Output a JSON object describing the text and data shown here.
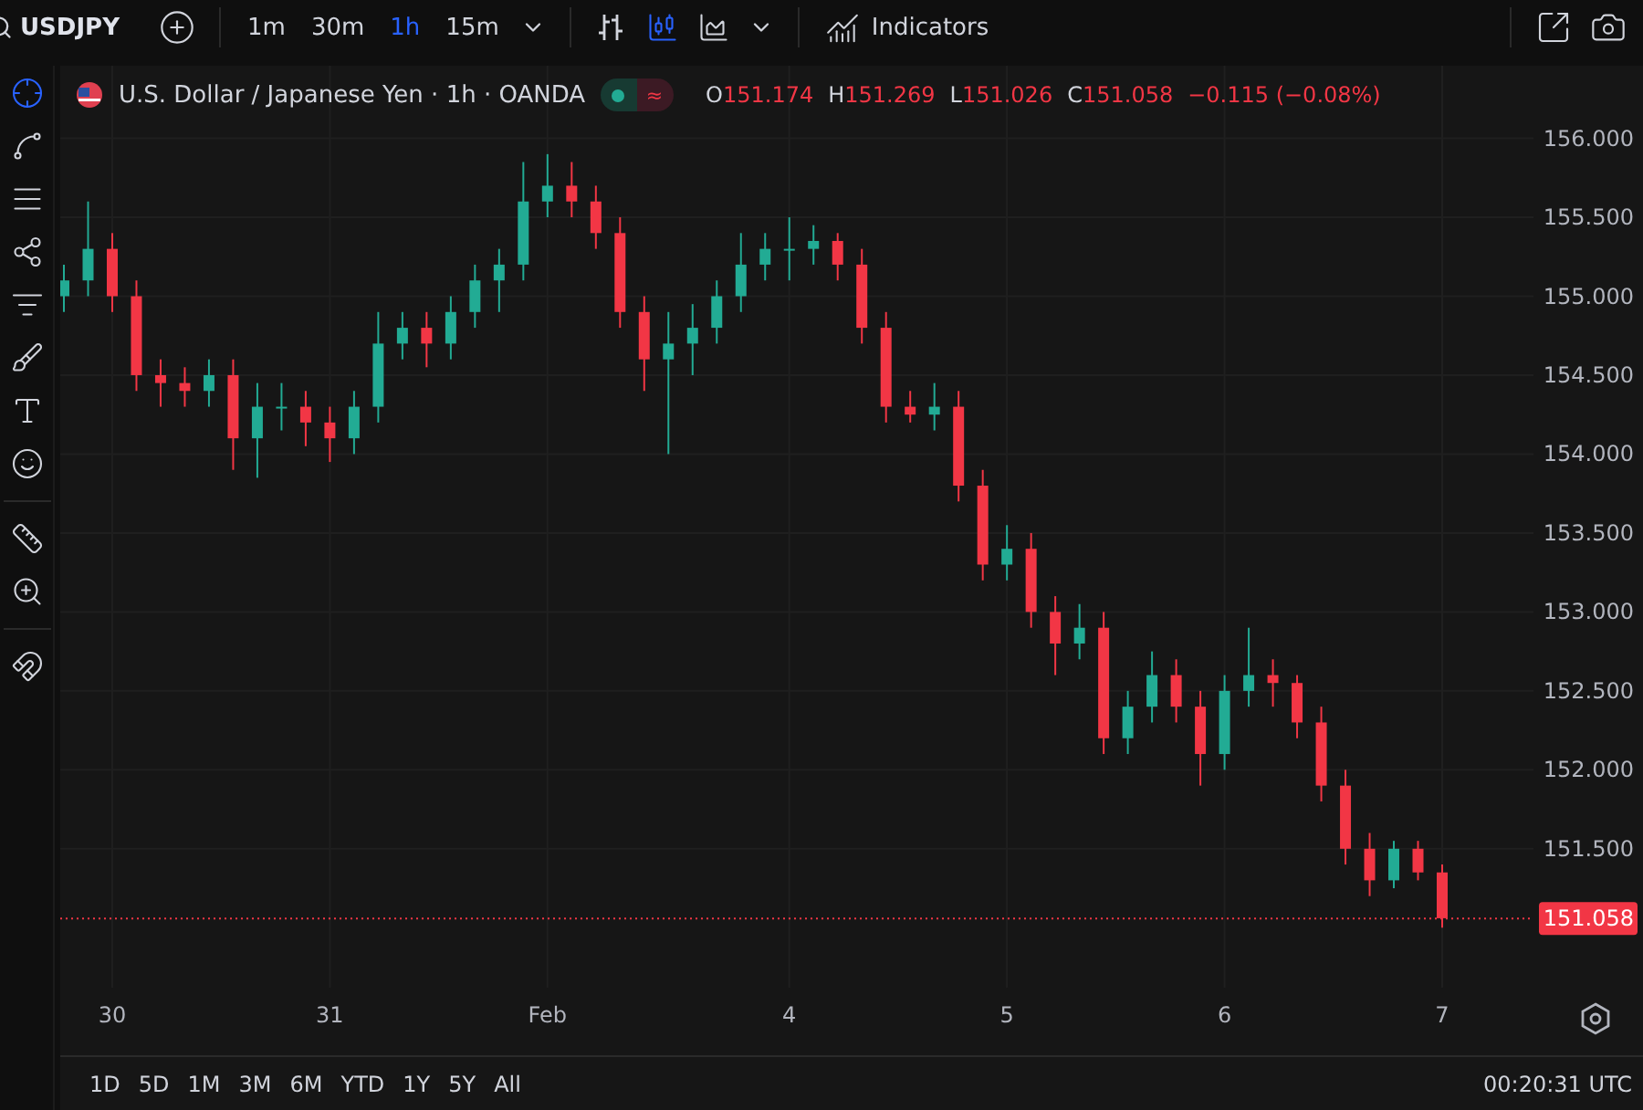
{
  "symbol": {
    "ticker": "USDJPY"
  },
  "intervals": [
    {
      "label": "1m",
      "selected": false
    },
    {
      "label": "30m",
      "selected": false
    },
    {
      "label": "1h",
      "selected": true
    },
    {
      "label": "15m",
      "selected": false
    }
  ],
  "chart_types": [
    {
      "kind": "bars",
      "selected": false
    },
    {
      "kind": "candles",
      "selected": true
    },
    {
      "kind": "area",
      "selected": false
    }
  ],
  "indicators_button": {
    "label": "Indicators"
  },
  "legend": {
    "title": "U.S. Dollar / Japanese Yen · 1h · OANDA",
    "market_open": true,
    "delay_mark": "≈",
    "ohlc": [
      {
        "key": "O",
        "value": "151.174"
      },
      {
        "key": "H",
        "value": "151.269"
      },
      {
        "key": "L",
        "value": "151.026"
      },
      {
        "key": "C",
        "value": "151.058"
      }
    ],
    "change": "−0.115 (−0.08%)"
  },
  "chart": {
    "chart_data": {
      "type": "candlestick",
      "grid": true,
      "ylim": [
        150.62,
        156.46
      ],
      "yticks": [
        {
          "value": 151.5,
          "label": "151.500"
        },
        {
          "value": 152,
          "label": "152.000"
        },
        {
          "value": 152.5,
          "label": "152.500"
        },
        {
          "value": 153,
          "label": "153.000"
        },
        {
          "value": 153.5,
          "label": "153.500"
        },
        {
          "value": 154,
          "label": "154.000"
        },
        {
          "value": 154.5,
          "label": "154.500"
        },
        {
          "value": 155,
          "label": "155.000"
        },
        {
          "value": 155.5,
          "label": "155.500"
        },
        {
          "value": 156,
          "label": "156.000"
        }
      ],
      "ref_lines": [
        {
          "axis": "y",
          "value": 151.058,
          "label": "151.058",
          "color": "#f23645"
        }
      ],
      "categories": [
        null,
        null,
        "30",
        null,
        null,
        null,
        null,
        null,
        null,
        null,
        null,
        "31",
        null,
        null,
        null,
        null,
        null,
        null,
        null,
        null,
        "Feb",
        null,
        null,
        null,
        null,
        null,
        null,
        null,
        null,
        null,
        "4",
        null,
        null,
        null,
        null,
        null,
        null,
        null,
        null,
        "5",
        null,
        null,
        null,
        null,
        null,
        null,
        null,
        null,
        "6",
        null,
        null,
        null,
        null,
        null,
        null,
        null,
        null,
        "7"
      ],
      "ohlc": [
        [
          155.0,
          155.2,
          154.9,
          155.1
        ],
        [
          155.1,
          155.6,
          155.0,
          155.3
        ],
        [
          155.3,
          155.4,
          154.9,
          155.0
        ],
        [
          155.0,
          155.1,
          154.4,
          154.5
        ],
        [
          154.5,
          154.6,
          154.3,
          154.45
        ],
        [
          154.45,
          154.55,
          154.3,
          154.4
        ],
        [
          154.4,
          154.6,
          154.3,
          154.5
        ],
        [
          154.5,
          154.6,
          153.9,
          154.1
        ],
        [
          154.1,
          154.45,
          153.85,
          154.3
        ],
        [
          154.3,
          154.45,
          154.15,
          154.3
        ],
        [
          154.3,
          154.4,
          154.05,
          154.2
        ],
        [
          154.2,
          154.3,
          153.95,
          154.1
        ],
        [
          154.1,
          154.4,
          154.0,
          154.3
        ],
        [
          154.3,
          154.9,
          154.2,
          154.7
        ],
        [
          154.7,
          154.9,
          154.6,
          154.8
        ],
        [
          154.8,
          154.9,
          154.55,
          154.7
        ],
        [
          154.7,
          155.0,
          154.6,
          154.9
        ],
        [
          154.9,
          155.2,
          154.8,
          155.1
        ],
        [
          155.1,
          155.3,
          154.9,
          155.2
        ],
        [
          155.2,
          155.85,
          155.1,
          155.6
        ],
        [
          155.6,
          155.9,
          155.5,
          155.7
        ],
        [
          155.7,
          155.85,
          155.5,
          155.6
        ],
        [
          155.6,
          155.7,
          155.3,
          155.4
        ],
        [
          155.4,
          155.5,
          154.8,
          154.9
        ],
        [
          154.9,
          155.0,
          154.4,
          154.6
        ],
        [
          154.6,
          154.9,
          154.0,
          154.7
        ],
        [
          154.7,
          154.95,
          154.5,
          154.8
        ],
        [
          154.8,
          155.1,
          154.7,
          155.0
        ],
        [
          155.0,
          155.4,
          154.9,
          155.2
        ],
        [
          155.2,
          155.4,
          155.1,
          155.3
        ],
        [
          155.3,
          155.5,
          155.1,
          155.3
        ],
        [
          155.3,
          155.45,
          155.2,
          155.35
        ],
        [
          155.35,
          155.4,
          155.1,
          155.2
        ],
        [
          155.2,
          155.3,
          154.7,
          154.8
        ],
        [
          154.8,
          154.9,
          154.2,
          154.3
        ],
        [
          154.3,
          154.4,
          154.2,
          154.25
        ],
        [
          154.25,
          154.45,
          154.15,
          154.3
        ],
        [
          154.3,
          154.4,
          153.7,
          153.8
        ],
        [
          153.8,
          153.9,
          153.2,
          153.3
        ],
        [
          153.3,
          153.55,
          153.2,
          153.4
        ],
        [
          153.4,
          153.5,
          152.9,
          153.0
        ],
        [
          153.0,
          153.1,
          152.6,
          152.8
        ],
        [
          152.8,
          153.05,
          152.7,
          152.9
        ],
        [
          152.9,
          153.0,
          152.1,
          152.2
        ],
        [
          152.2,
          152.5,
          152.1,
          152.4
        ],
        [
          152.4,
          152.75,
          152.3,
          152.6
        ],
        [
          152.6,
          152.7,
          152.3,
          152.4
        ],
        [
          152.4,
          152.5,
          151.9,
          152.1
        ],
        [
          152.1,
          152.6,
          152.0,
          152.5
        ],
        [
          152.5,
          152.9,
          152.4,
          152.6
        ],
        [
          152.6,
          152.7,
          152.4,
          152.55
        ],
        [
          152.55,
          152.6,
          152.2,
          152.3
        ],
        [
          152.3,
          152.4,
          151.8,
          151.9
        ],
        [
          151.9,
          152.0,
          151.4,
          151.5
        ],
        [
          151.5,
          151.6,
          151.2,
          151.3
        ],
        [
          151.3,
          151.55,
          151.25,
          151.5
        ],
        [
          151.5,
          151.55,
          151.3,
          151.35
        ],
        [
          151.35,
          151.4,
          151.0,
          151.06
        ]
      ]
    }
  },
  "ranges": [
    {
      "label": "1D"
    },
    {
      "label": "5D"
    },
    {
      "label": "1M"
    },
    {
      "label": "3M"
    },
    {
      "label": "6M"
    },
    {
      "label": "YTD"
    },
    {
      "label": "1Y"
    },
    {
      "label": "5Y"
    },
    {
      "label": "All"
    }
  ],
  "clock": "00:20:31 UTC"
}
